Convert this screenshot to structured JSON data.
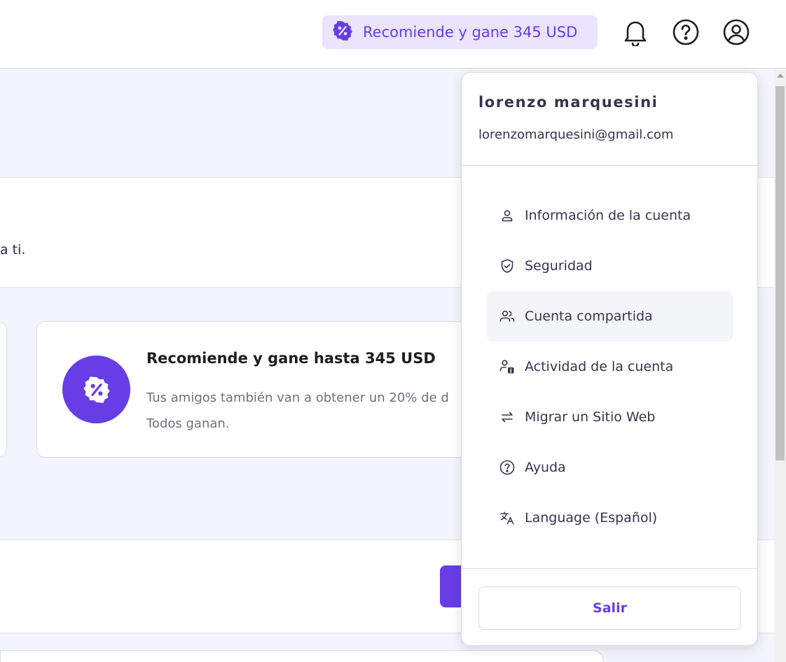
{
  "header": {
    "promo_label": "Recomiende y gane 345 USD"
  },
  "background": {
    "text_fragment": "a ti.",
    "referral_card": {
      "title": "Recomiende y gane hasta 345 USD",
      "description_line1": "Tus amigos también van a obtener un 20% de d",
      "description_line2": "Todos ganan."
    }
  },
  "account_menu": {
    "user_name": "lorenzo marquesini",
    "user_email": "lorenzomarquesini@gmail.com",
    "items": [
      {
        "label": "Información de la cuenta",
        "icon": "user-icon"
      },
      {
        "label": "Seguridad",
        "icon": "shield-check-icon"
      },
      {
        "label": "Cuenta compartida",
        "icon": "users-icon"
      },
      {
        "label": "Actividad de la cuenta",
        "icon": "user-info-icon"
      },
      {
        "label": "Migrar un Sitio Web",
        "icon": "swap-arrows-icon"
      },
      {
        "label": "Ayuda",
        "icon": "help-circle-icon"
      },
      {
        "label": "Language (Español)",
        "icon": "translate-icon"
      }
    ],
    "active_item": "Cuenta compartida",
    "logout_label": "Salir"
  },
  "colors": {
    "accent": "#673de6",
    "accent_light": "#ebe4ff",
    "text_dark": "#36344d",
    "page_bg": "#f4f4fc",
    "active_item_bg": "#f4f5f9"
  }
}
